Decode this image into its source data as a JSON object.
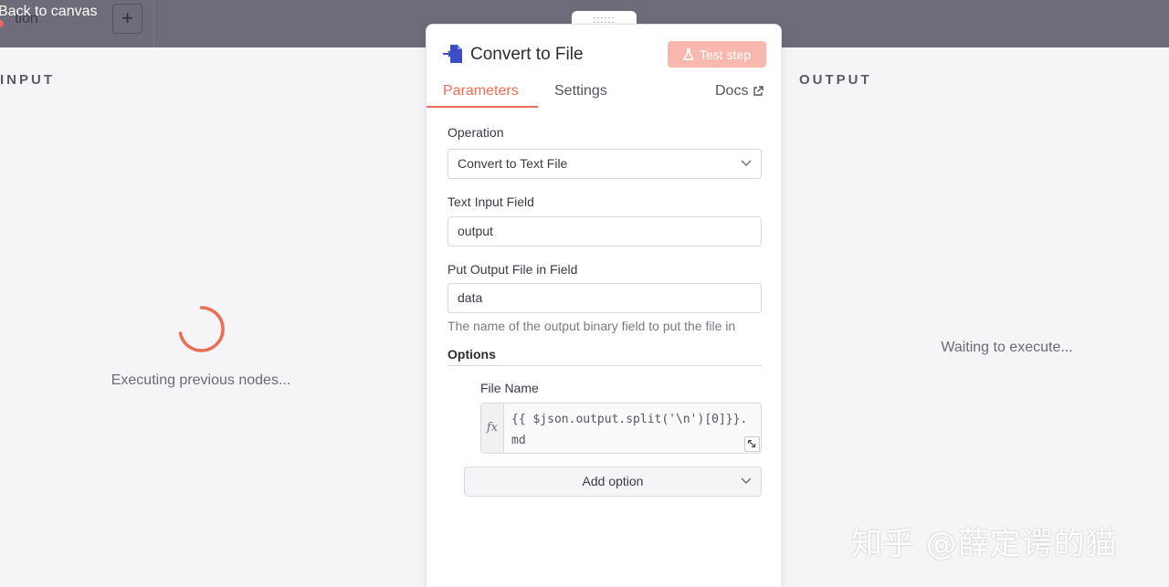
{
  "topbar": {
    "back_label": "Back to canvas",
    "ghost_text": "tion",
    "add_button": "+"
  },
  "input_panel": {
    "title": "INPUT",
    "status": "Executing previous nodes..."
  },
  "output_panel": {
    "title": "OUTPUT",
    "status": "Waiting to execute..."
  },
  "drag_handle": "::::::",
  "node": {
    "title": "Convert to File",
    "test_button": "Test step",
    "tabs": [
      {
        "label": "Parameters",
        "active": true
      },
      {
        "label": "Settings",
        "active": false
      },
      {
        "label": "Docs",
        "active": false
      }
    ],
    "fields": {
      "operation_label": "Operation",
      "operation_value": "Convert to Text File",
      "text_input_label": "Text Input Field",
      "text_input_value": "output",
      "output_file_label": "Put Output File in Field",
      "output_file_value": "data",
      "output_file_hint": "The name of the output binary field to put the file in"
    },
    "options": {
      "title": "Options",
      "file_name_label": "File Name",
      "fx_symbol": "fx",
      "file_name_expression": "{{ $json.output.split('\\n')[0]}}.\nmd",
      "add_option_label": "Add option"
    }
  },
  "watermark": "知乎 @薛定谔的猫",
  "colors": {
    "accent": "#ea6f57",
    "test_button": "#f9b8ae",
    "topbar": "#6e6c7a",
    "node_icon": "#3d4cc7"
  },
  "icons": [
    "convert-to-file-icon",
    "flask-icon",
    "external-link-icon",
    "chevron-down-icon",
    "expand-icon",
    "spinner-icon"
  ]
}
